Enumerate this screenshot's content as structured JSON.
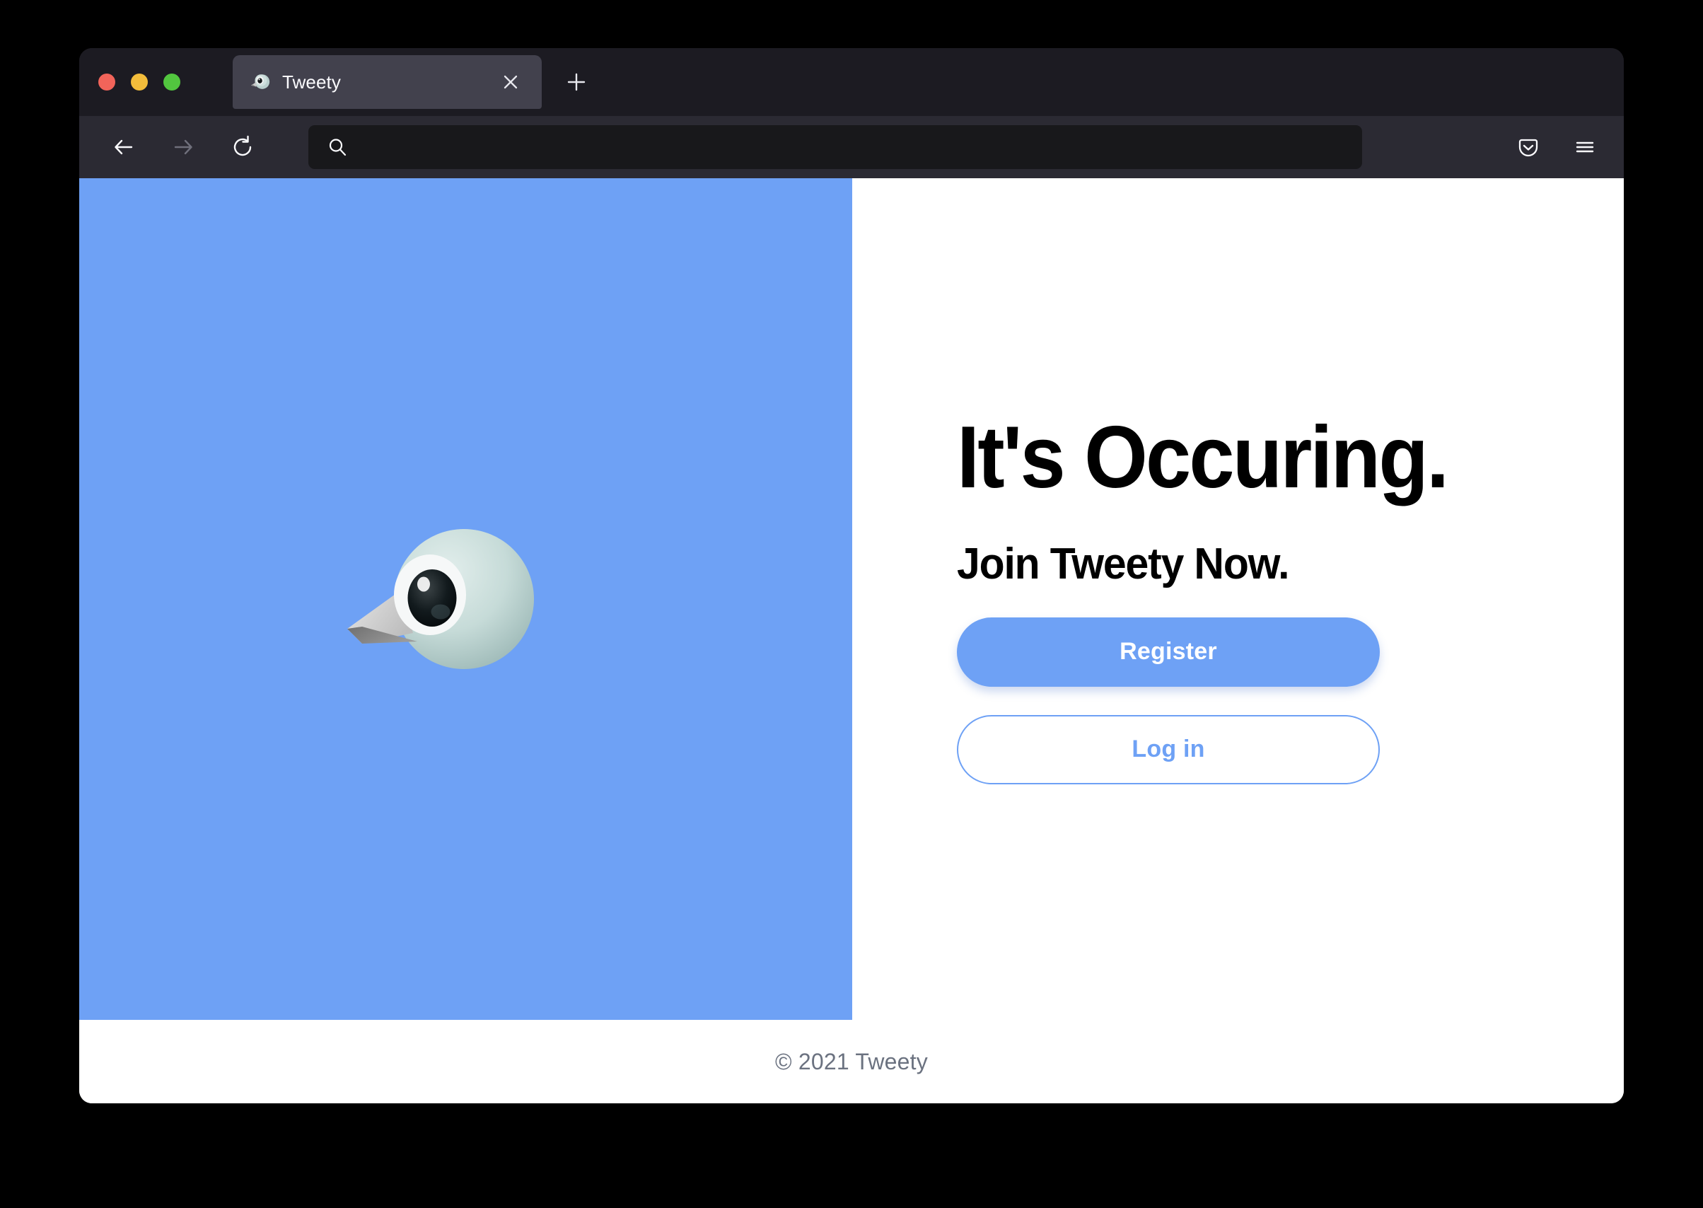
{
  "browser": {
    "window_controls": [
      {
        "name": "close",
        "color": "#f2645a"
      },
      {
        "name": "minimize",
        "color": "#f3bd3b"
      },
      {
        "name": "maximize",
        "color": "#52c63f"
      }
    ],
    "tab": {
      "title": "Tweety",
      "favicon": "bird-emoji",
      "close_label": "×"
    },
    "new_tab_label": "+",
    "toolbar": {
      "back_label": "Back",
      "forward_label": "Forward",
      "reload_label": "Reload",
      "pocket_label": "Save to Pocket",
      "menu_label": "Open application menu"
    },
    "address_bar": {
      "value": "",
      "placeholder": "",
      "icon": "search-icon"
    }
  },
  "page": {
    "hero": {
      "graphic": "bird-emoji",
      "background_color": "#6ea1f5"
    },
    "headline": "It's Occuring.",
    "subheading": "Join Tweety Now.",
    "register_label": "Register",
    "login_label": "Log in",
    "footer": "© 2021 Tweety",
    "accent_color": "#6ea1f5",
    "footer_color": "#6b7280"
  }
}
